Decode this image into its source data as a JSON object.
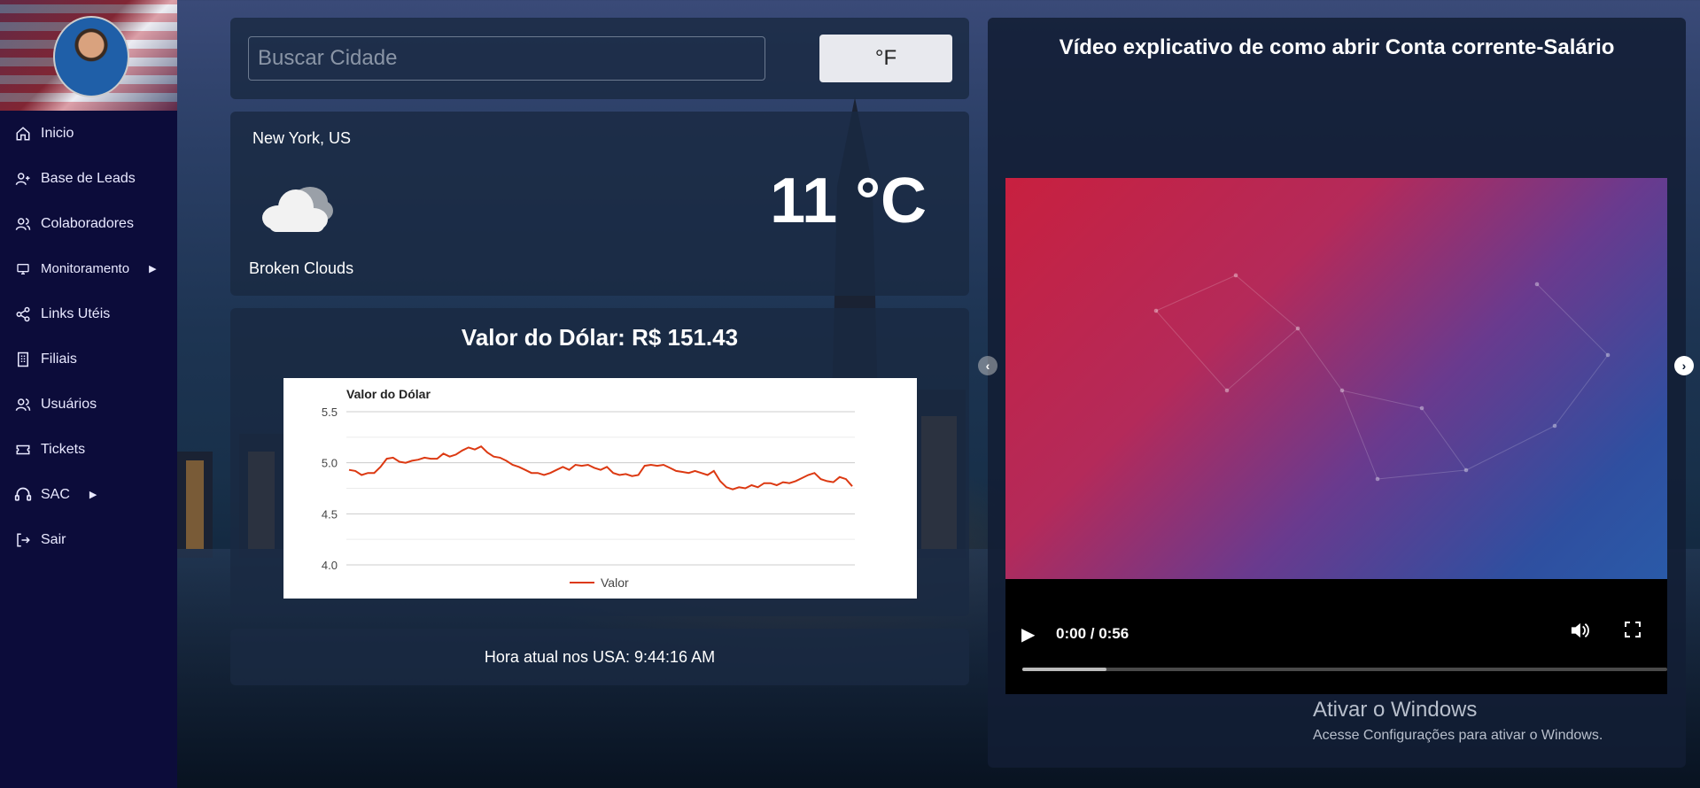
{
  "sidebar": {
    "items": [
      {
        "label": "Inicio",
        "icon": "home-icon"
      },
      {
        "label": "Base de Leads",
        "icon": "user-plus-icon"
      },
      {
        "label": "Colaboradores",
        "icon": "users-icon"
      },
      {
        "label": "Monitoramento",
        "icon": "monitor-icon",
        "has_submenu": true
      },
      {
        "label": "Links Utéis",
        "icon": "share-icon"
      },
      {
        "label": "Filiais",
        "icon": "building-icon"
      },
      {
        "label": "Usuários",
        "icon": "users-icon"
      },
      {
        "label": "Tickets",
        "icon": "ticket-icon"
      },
      {
        "label": "SAC",
        "icon": "headset-icon",
        "has_submenu": true
      },
      {
        "label": "Sair",
        "icon": "logout-icon"
      }
    ]
  },
  "search": {
    "placeholder": "Buscar Cidade",
    "unit_button": "°F"
  },
  "weather": {
    "city": "New York, US",
    "temperature": "11 °C",
    "condition": "Broken Clouds",
    "icon": "cloud-icon"
  },
  "dolar": {
    "title": "Valor do Dólar: R$ 151.43",
    "chart_data": {
      "type": "line",
      "title": "Valor do Dólar",
      "ylim": [
        4.0,
        5.5
      ],
      "yticks": [
        "5.5",
        "5.0",
        "4.5",
        "4.0"
      ],
      "series": [
        {
          "name": "Valor",
          "color": "#dc3912",
          "values": [
            4.93,
            4.92,
            4.88,
            4.9,
            4.9,
            4.96,
            5.04,
            5.05,
            5.01,
            5.0,
            5.02,
            5.03,
            5.05,
            5.04,
            5.04,
            5.09,
            5.06,
            5.08,
            5.12,
            5.15,
            5.13,
            5.16,
            5.1,
            5.06,
            5.05,
            5.02,
            4.98,
            4.96,
            4.93,
            4.9,
            4.9,
            4.88,
            4.9,
            4.93,
            4.96,
            4.93,
            4.98,
            4.97,
            4.98,
            4.95,
            4.93,
            4.96,
            4.9,
            4.88,
            4.89,
            4.87,
            4.88,
            4.97,
            4.98,
            4.97,
            4.98,
            4.95,
            4.92,
            4.91,
            4.9,
            4.92,
            4.9,
            4.88,
            4.92,
            4.82,
            4.76,
            4.74,
            4.76,
            4.75,
            4.78,
            4.76,
            4.8,
            4.8,
            4.78,
            4.81,
            4.8,
            4.82,
            4.85,
            4.88,
            4.9,
            4.84,
            4.82,
            4.81,
            4.86,
            4.84,
            4.77
          ]
        }
      ],
      "legend": "bottom"
    }
  },
  "hora": {
    "text": "Hora atual nos USA: 9:44:16 AM"
  },
  "video": {
    "title": "Vídeo explicativo de como abrir Conta corrente-Salário",
    "time": "0:00 / 0:56",
    "progress": 0.13
  },
  "windows": {
    "title": "Ativar o Windows",
    "subtitle": "Acesse Configurações para ativar o Windows."
  }
}
